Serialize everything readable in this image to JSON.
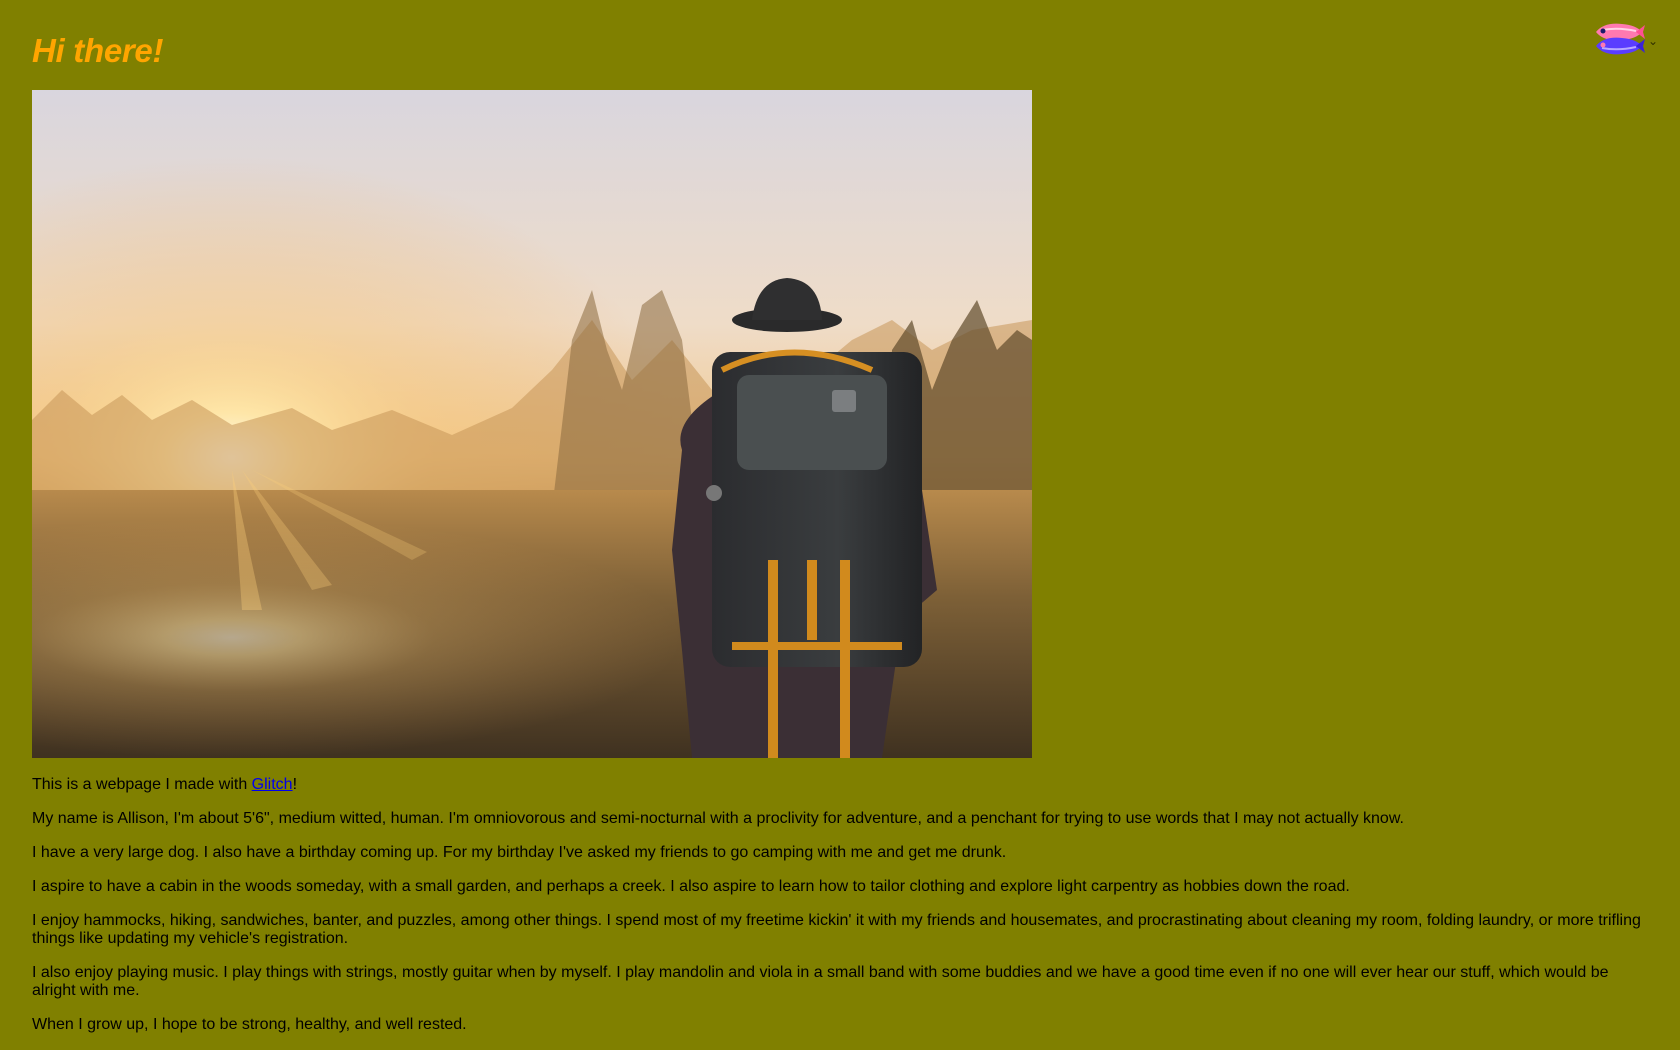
{
  "header": {
    "title": "Hi there!"
  },
  "hero_image": {
    "alt": "Hiker with a large backpack and hat looking at a sunrise over a grassy field"
  },
  "intro": {
    "before_link": "This is a webpage I made with ",
    "link_text": "Glitch",
    "after_link": "!"
  },
  "paragraphs": [
    "My name is Allison, I'm about 5'6\", medium witted, human. I'm omniovorous and semi-nocturnal with a proclivity for adventure, and a penchant for trying to use words that I may not actually know.",
    "I have a very large dog. I also have a birthday coming up. For my birthday I've asked my friends to go camping with me and get me drunk.",
    "I aspire to have a cabin in the woods someday, with a small garden, and perhaps a creek. I also aspire to learn how to tailor clothing and explore light carpentry as hobbies down the road.",
    "I enjoy hammocks, hiking, sandwiches, banter, and puzzles, among other things. I spend most of my freetime kickin' it with my friends and housemates, and procrastinating about cleaning my room, folding laundry, or more trifling things like updating my vehicle's registration.",
    "I also enjoy playing music. I play things with strings, mostly guitar when by myself. I play mandolin and viola in a small band with some buddies and we have a good time even if no one will ever hear our stuff, which would be alright with me.",
    "When I grow up, I hope to be strong, healthy, and well rested."
  ],
  "glitch_widget": {
    "icon": "glitch-fish-logo-icon",
    "dropdown_icon": "chevron-down-icon"
  },
  "colors": {
    "background": "#808000",
    "title": "#ffa500",
    "text": "#000000",
    "link": "#0000ee"
  }
}
